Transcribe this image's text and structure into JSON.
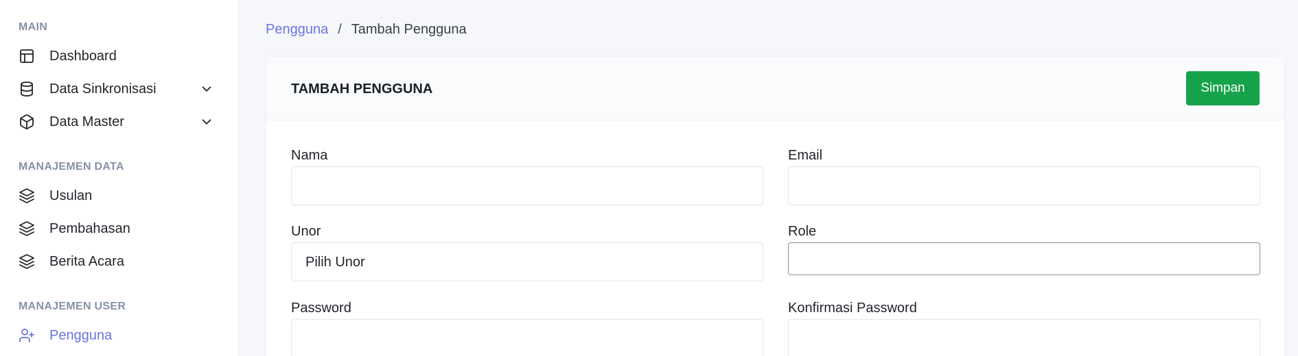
{
  "sidebar": {
    "sections": [
      {
        "title": "MAIN"
      },
      {
        "title": "MANAJEMEN DATA"
      },
      {
        "title": "MANAJEMEN USER"
      }
    ],
    "items": [
      {
        "label": "Dashboard",
        "icon": "layout-icon"
      },
      {
        "label": "Data Sinkronisasi",
        "icon": "database-icon",
        "expandable": true
      },
      {
        "label": "Data Master",
        "icon": "box-icon",
        "expandable": true
      },
      {
        "label": "Usulan",
        "icon": "layers-icon"
      },
      {
        "label": "Pembahasan",
        "icon": "layers-icon"
      },
      {
        "label": "Berita Acara",
        "icon": "layers-icon"
      },
      {
        "label": "Pengguna",
        "icon": "user-plus-icon",
        "active": true
      }
    ]
  },
  "breadcrumb": {
    "parent": "Pengguna",
    "separator": "/",
    "current": "Tambah Pengguna"
  },
  "card": {
    "title": "TAMBAH PENGGUNA",
    "save_label": "Simpan"
  },
  "form": {
    "nama": {
      "label": "Nama",
      "value": ""
    },
    "email": {
      "label": "Email",
      "value": ""
    },
    "unor": {
      "label": "Unor",
      "selected": "Pilih Unor"
    },
    "role": {
      "label": "Role",
      "value": ""
    },
    "password": {
      "label": "Password",
      "value": ""
    },
    "konfirmasi": {
      "label": "Konfirmasi Password",
      "value": ""
    }
  },
  "colors": {
    "accent": "#6a74e0",
    "save_button": "#16a34a",
    "section_title": "#8592a6"
  }
}
